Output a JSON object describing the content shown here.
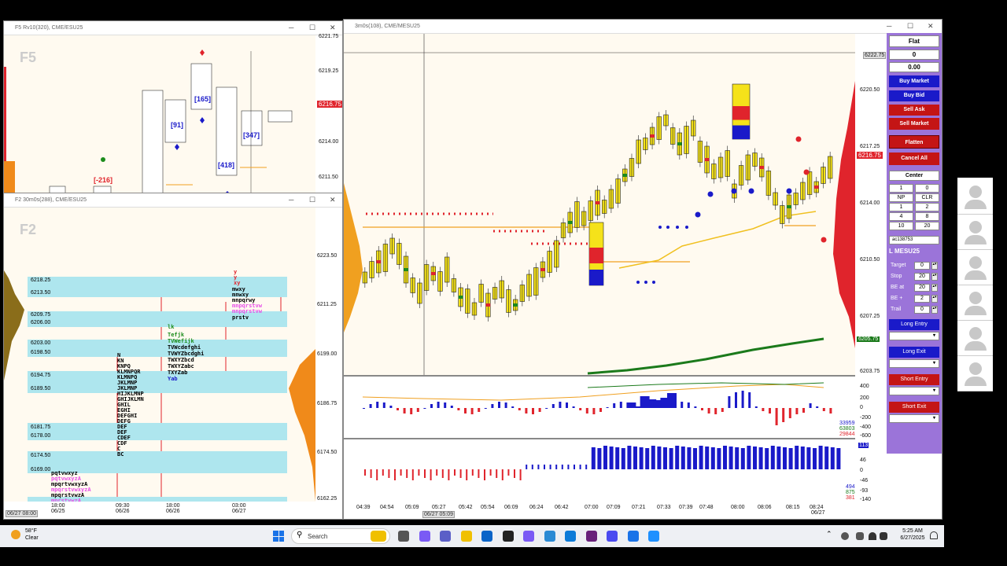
{
  "windows": {
    "f5": {
      "title": "F5 Rv10(320), CME/ESU25",
      "tag": "F5",
      "prices": [
        "6221.75",
        "6219.25",
        "6216.75",
        "6214.00",
        "6211.50"
      ],
      "current_price": "6216.75",
      "labels": [
        "[-216]",
        "[91]",
        "[165]",
        "[418]",
        "[347]"
      ]
    },
    "f2": {
      "title": "F2 30m0s(288), CME/ESU25",
      "tag": "F2",
      "prices": [
        "6223.50",
        "6211.25",
        "6199.00",
        "6186.75",
        "6174.50",
        "6162.25"
      ],
      "levels": [
        "6218.25",
        "6213.50",
        "6209.75",
        "6206.00",
        "6203.00",
        "6198.50",
        "6194.75",
        "6189.50",
        "6181.75",
        "6178.00",
        "6174.50",
        "6169.00"
      ],
      "xticks": [
        {
          "time": "18:00",
          "date": "06/25"
        },
        {
          "time": "09:30",
          "date": "06/26"
        },
        {
          "time": "18:00",
          "date": "06/26"
        },
        {
          "time": "03:00",
          "date": "06/27"
        }
      ],
      "cursor_date": "06/27 08:00",
      "tpo_rows": [
        "y",
        "y",
        "xy",
        "mwxy",
        "mnwxy",
        "mnpqrwy",
        "mnpqrstvw",
        "mnpqrstvw",
        "prstv",
        "N",
        "KN",
        "KNPQ",
        "KLMNPQR",
        "KLMNPQ",
        "JKLMNP",
        "JKLMNP",
        "HIJKLMNP",
        "GHIJKLMN",
        "GHIL",
        "EGHI",
        "DEFGHI",
        "DEFG",
        "DEF",
        "DEF",
        "CDEF",
        "CDF",
        "C",
        "BC",
        "pqtvwxyz",
        "pqtvwxyzA",
        "mpqrtvwxyzA",
        "mpqrstvwxyzA",
        "mpqrstvwzA",
        "mprstvwzA",
        "lk",
        "Tefjk",
        "TVWefijk",
        "TVWcdefghi",
        "TVWYZbcdghi",
        "TWXYZbcd",
        "TWXYZabc",
        "TXYZab",
        "Yab"
      ]
    },
    "main": {
      "title": "3m0s(108), CME/MESU25",
      "prices": [
        "6222.75",
        "6220.50",
        "6217.25",
        "6214.00",
        "6210.50",
        "6207.25",
        "6203.75"
      ],
      "current_price": "6216.75",
      "green_price": "6205.75",
      "osc1_ticks": [
        "400",
        "200",
        "0",
        "-200",
        "-400",
        "-600"
      ],
      "osc1_values": [
        "33959",
        "63803",
        "29844"
      ],
      "osc2_ticks": [
        "113",
        "46",
        "0",
        "-46",
        "-93",
        "-140"
      ],
      "osc2_values": [
        "494",
        "875",
        "381"
      ],
      "xticks": [
        "04:39",
        "04:54",
        "05:09",
        "05:27",
        "05:42",
        "05:54",
        "06:09",
        "06:24",
        "06:42",
        "07:00",
        "07:09",
        "07:21",
        "07:33",
        "07:39",
        "07:48",
        "08:00",
        "08:06",
        "08:15",
        "08:24"
      ],
      "last_date": "06/27",
      "cursor_date": "06/27 05:09"
    }
  },
  "trade_panel": {
    "position": "Flat",
    "qty": "0",
    "pnl": "0.00",
    "buttons": {
      "buy_market": "Buy Market",
      "buy_bid": "Buy Bid",
      "sell_ask": "Sell Ask",
      "sell_market": "Sell Market",
      "flatten": "Flatten",
      "cancel_all": "Cancel All",
      "center": "Center",
      "long_entry": "Long Entry",
      "long_exit": "Long Exit",
      "short_entry": "Short Entry",
      "short_exit": "Short Exit"
    },
    "qty_grid": [
      "1",
      "0",
      "NP",
      "CLR",
      "1",
      "2",
      "4",
      "8",
      "10",
      "20"
    ],
    "account": "ac138753",
    "instrument": "L MESU25",
    "fields": [
      {
        "label": "Target",
        "value": "0"
      },
      {
        "label": "Stop",
        "value": "20"
      },
      {
        "label": "BE at",
        "value": "20"
      },
      {
        "label": "BE +",
        "value": "2"
      },
      {
        "label": "Trail",
        "value": "0"
      }
    ],
    "colors": {
      "panel": "#9b74d9",
      "buy": "#1a1ac9",
      "sell": "#c41515"
    }
  },
  "taskbar": {
    "weather_temp": "58°F",
    "weather_desc": "Clear",
    "search_placeholder": "Search",
    "time": "5:25 AM",
    "date": "6/27/2025"
  }
}
